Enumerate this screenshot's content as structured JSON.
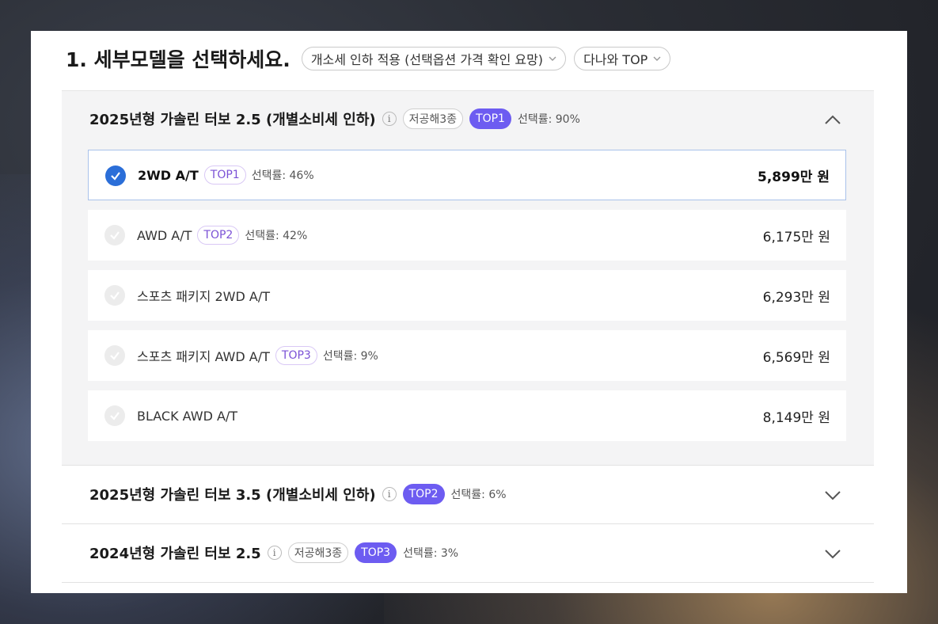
{
  "heading": {
    "title": "1. 세부모델을 선택하세요.",
    "dropdown_tax": "개소세 인하 적용 (선택옵션 가격 확인 요망)",
    "dropdown_sort": "다나와 TOP"
  },
  "groups": [
    {
      "title": "2025년형 가솔린 터보 2.5 (개별소비세 인하)",
      "eco_tag": "저공해3종",
      "rank": "TOP1",
      "rate": "선택률: 90%",
      "expanded": true
    },
    {
      "title": "2025년형 가솔린 터보 3.5 (개별소비세 인하)",
      "eco_tag": "",
      "rank": "TOP2",
      "rate": "선택률: 6%",
      "expanded": false
    },
    {
      "title": "2024년형 가솔린 터보 2.5",
      "eco_tag": "저공해3종",
      "rank": "TOP3",
      "rate": "선택률: 3%",
      "expanded": false
    }
  ],
  "options": [
    {
      "name": "2WD A/T",
      "rank": "TOP1",
      "rate": "선택률: 46%",
      "price": "5,899만 원",
      "selected": true
    },
    {
      "name": "AWD A/T",
      "rank": "TOP2",
      "rate": "선택률: 42%",
      "price": "6,175만 원",
      "selected": false
    },
    {
      "name": "스포츠 패키지 2WD A/T",
      "rank": "",
      "rate": "",
      "price": "6,293만 원",
      "selected": false
    },
    {
      "name": "스포츠 패키지 AWD A/T",
      "rank": "TOP3",
      "rate": "선택률: 9%",
      "price": "6,569만 원",
      "selected": false
    },
    {
      "name": "BLACK AWD A/T",
      "rank": "",
      "rate": "",
      "price": "8,149만 원",
      "selected": false
    }
  ],
  "icons": {
    "info": "info-icon",
    "check": "check-icon",
    "chevron_up": "chevron-up-icon",
    "chevron_down": "chevron-down-icon"
  },
  "colors": {
    "accent_purple": "#6d5cf1",
    "check_blue": "#2b6ed8",
    "selected_border": "#a9c2ea"
  }
}
